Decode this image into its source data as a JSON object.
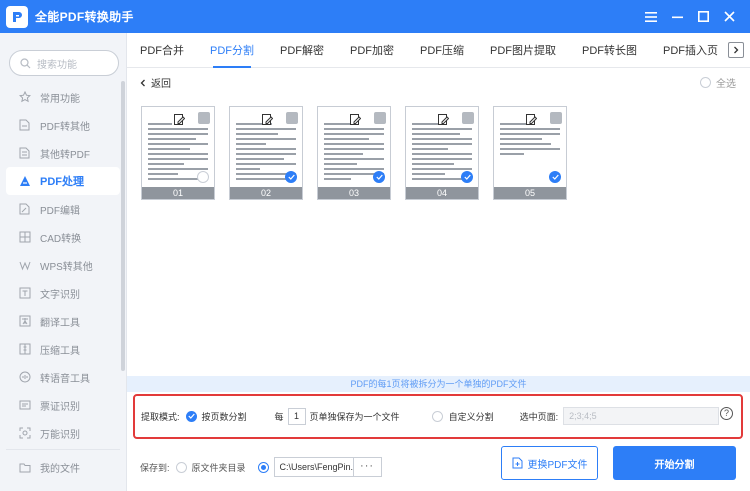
{
  "app": {
    "title": "全能PDF转换助手"
  },
  "window": {
    "controls": [
      "menu",
      "minimize",
      "maximize",
      "close"
    ]
  },
  "sidebar": {
    "search_placeholder": "搜索功能",
    "items": [
      {
        "label": "常用功能",
        "icon": "star-icon"
      },
      {
        "label": "PDF转其他",
        "icon": "pdf-export-icon"
      },
      {
        "label": "其他转PDF",
        "icon": "pdf-import-icon"
      },
      {
        "label": "PDF处理",
        "icon": "pdf-process-icon",
        "active": true
      },
      {
        "label": "PDF编辑",
        "icon": "pdf-edit-icon"
      },
      {
        "label": "CAD转换",
        "icon": "cad-icon"
      },
      {
        "label": "WPS转其他",
        "icon": "wps-icon"
      },
      {
        "label": "文字识别",
        "icon": "ocr-icon"
      },
      {
        "label": "翻译工具",
        "icon": "translate-icon"
      },
      {
        "label": "压缩工具",
        "icon": "compress-icon"
      },
      {
        "label": "转语音工具",
        "icon": "speech-icon"
      },
      {
        "label": "票证识别",
        "icon": "ticket-icon"
      },
      {
        "label": "万能识别",
        "icon": "universal-recognize-icon"
      }
    ],
    "myfiles": {
      "label": "我的文件",
      "icon": "folder-icon"
    }
  },
  "tabs": [
    "PDF合并",
    "PDF分割",
    "PDF解密",
    "PDF加密",
    "PDF压缩",
    "PDF图片提取",
    "PDF转长图",
    "PDF插入页"
  ],
  "active_tab": 1,
  "toolbar": {
    "back_label": "返回",
    "select_all_label": "全选"
  },
  "pages": [
    {
      "label": "01",
      "checked": false
    },
    {
      "label": "02",
      "checked": true
    },
    {
      "label": "03",
      "checked": true
    },
    {
      "label": "04",
      "checked": true
    },
    {
      "label": "05",
      "checked": true
    }
  ],
  "banner": {
    "text": "PDF的每1页将被拆分为一个单独的PDF文件"
  },
  "options": {
    "mode_label": "提取模式:",
    "by_pages_label": "按页数分割",
    "every_label": "每",
    "every_value": "1",
    "every_suffix": "页单独保存为一个文件",
    "custom_label": "自定义分割",
    "selected_pages_label": "选中页面:",
    "selected_pages_value": "2;3;4;5",
    "help_label": "?"
  },
  "save": {
    "label": "保存到:",
    "original_dir_label": "原文件夹目录",
    "path_value": "C:\\Users\\FengPin...",
    "browse_label": "···"
  },
  "buttons": {
    "change_pdf": "更换PDF文件",
    "start_split": "开始分割"
  },
  "colors": {
    "accent": "#2d7ef7",
    "highlight_border": "#e23a3a"
  }
}
